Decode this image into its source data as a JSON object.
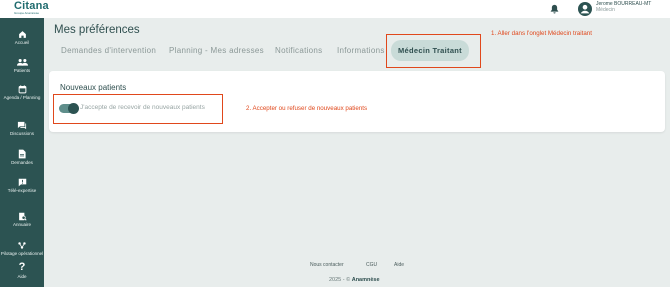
{
  "topbar": {
    "logo": "Citana",
    "logo_sub": "Groupe Anamnèse",
    "user_name": "Jerome BOURREAU-MT",
    "user_role": "Médecin"
  },
  "sidebar": {
    "items": [
      {
        "label": "Accueil",
        "icon": "home-icon"
      },
      {
        "label": "Patients",
        "icon": "patients-icon"
      },
      {
        "label": "Agenda / Planning",
        "icon": "calendar-icon"
      },
      {
        "label": "Discussions",
        "icon": "chat-icon"
      },
      {
        "label": "Demandes",
        "icon": "document-icon"
      },
      {
        "label": "Télé-expertise",
        "icon": "tele-expertise-icon"
      },
      {
        "label": "Annuaire",
        "icon": "directory-icon"
      },
      {
        "label": "Pilotage opérationnel",
        "icon": "pilotage-icon"
      },
      {
        "label": "Aide",
        "icon": "help-icon"
      }
    ]
  },
  "main": {
    "title": "Mes préférences",
    "tabs": [
      {
        "label": "Demandes d'intervention"
      },
      {
        "label": "Planning - Mes adresses"
      },
      {
        "label": "Notifications"
      },
      {
        "label": "Informations"
      },
      {
        "label": "Médecin Traitant",
        "active": true
      }
    ],
    "card": {
      "title": "Nouveaux patients",
      "toggle_label": "J'accepte de recevoir de nouveaux patients",
      "toggle_on": true
    }
  },
  "annotations": {
    "step1": "1. Aller dans l'onglet Médecin traitant",
    "step2": "2. Accepter ou refuser de nouveaux patients",
    "color": "#e0481c"
  },
  "footer": {
    "links": [
      "Nous contacter",
      "CGU",
      "Aide"
    ],
    "copyright": "2025 - ©",
    "brand": "Anamnèse"
  },
  "colors": {
    "sidebar": "#2c5352",
    "background": "#e8edec",
    "accent": "#5f8e8b",
    "active_tab": "#c9dbd8"
  }
}
